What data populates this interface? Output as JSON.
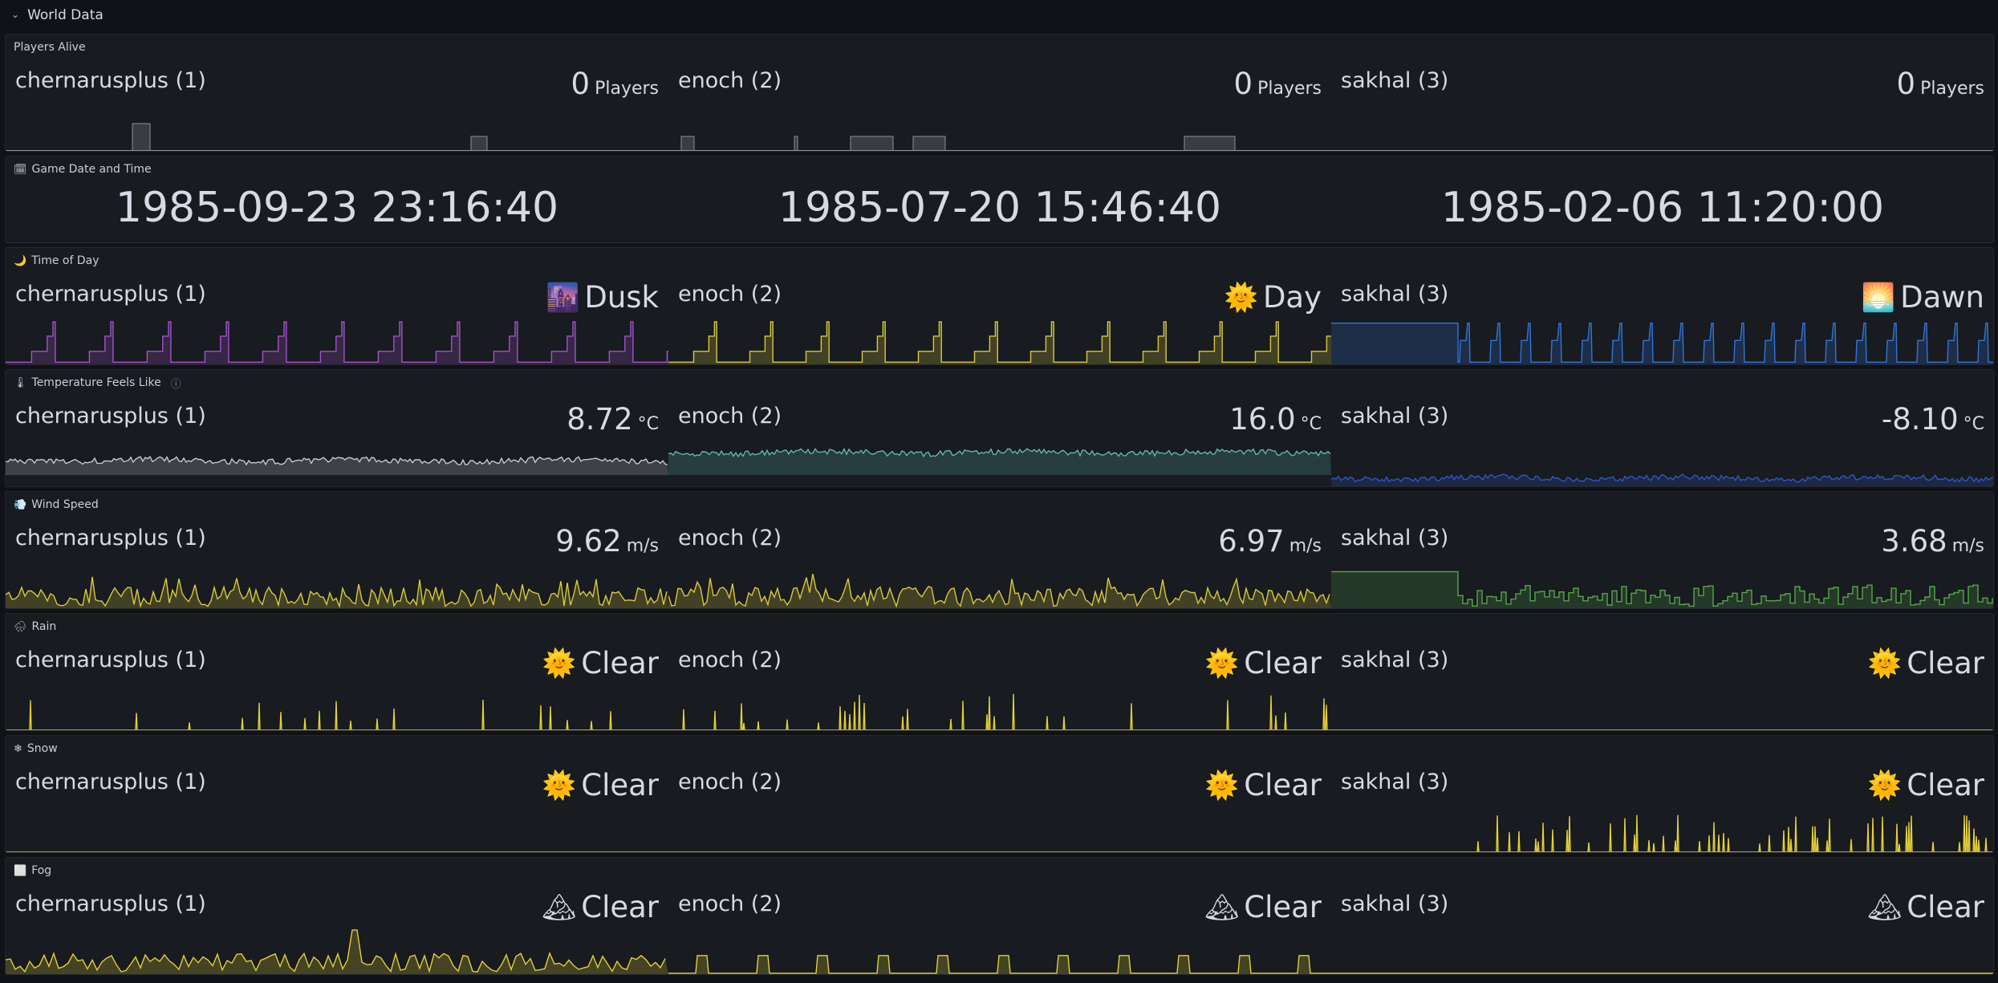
{
  "row": {
    "title": "World Data"
  },
  "icons": {
    "chevron": "chevron-down-icon",
    "calendar": "calendar-icon",
    "moon": "crescent-moon-icon",
    "thermometer": "thermometer-icon",
    "wind": "wind-icon",
    "rain": "rain-cloud-icon",
    "snow": "snowflake-icon",
    "fog": "fog-icon",
    "info": "info-icon"
  },
  "panels": [
    {
      "key": "players",
      "title": "Players Alive",
      "icon": "",
      "cells": [
        {
          "name": "chernarusplus (1)",
          "value": "0",
          "unit": "Players",
          "color": "#8f9094"
        },
        {
          "name": "enoch (2)",
          "value": "0",
          "unit": "Players",
          "color": "#8f9094"
        },
        {
          "name": "sakhal (3)",
          "value": "0",
          "unit": "Players",
          "color": "#8f9094"
        }
      ]
    },
    {
      "key": "datetime",
      "title": "Game Date and Time",
      "icon": "🗓",
      "cells": [
        {
          "value": "1985-09-23 23:16:40"
        },
        {
          "value": "1985-07-20 15:46:40"
        },
        {
          "value": "1985-02-06 11:20:00"
        }
      ]
    },
    {
      "key": "timeofday",
      "title": "Time of Day",
      "icon": "🌙",
      "cells": [
        {
          "name": "chernarusplus (1)",
          "emoji": "🌆",
          "value": "Dusk",
          "color": "#a352cc"
        },
        {
          "name": "enoch (2)",
          "emoji": "🌞",
          "value": "Day",
          "color": "#d9c93a"
        },
        {
          "name": "sakhal (3)",
          "emoji": "🌅",
          "value": "Dawn",
          "color": "#3274d9"
        }
      ]
    },
    {
      "key": "temperature",
      "title": "Temperature Feels Like",
      "icon": "🌡",
      "cells": [
        {
          "name": "chernarusplus (1)",
          "value": "8.72",
          "unit": "°C",
          "color": "#c8c9cf"
        },
        {
          "name": "enoch (2)",
          "value": "16.0",
          "unit": "°C",
          "color": "#5fb8b0"
        },
        {
          "name": "sakhal (3)",
          "value": "-8.10",
          "unit": "°C",
          "color": "#2f56c9"
        }
      ]
    },
    {
      "key": "wind",
      "title": "Wind Speed",
      "icon": "💨",
      "cells": [
        {
          "name": "chernarusplus (1)",
          "value": "9.62",
          "unit": "m/s",
          "color": "#d9c93a"
        },
        {
          "name": "enoch (2)",
          "value": "6.97",
          "unit": "m/s",
          "color": "#d9c93a"
        },
        {
          "name": "sakhal (3)",
          "value": "3.68",
          "unit": "m/s",
          "color": "#56a64b"
        }
      ]
    },
    {
      "key": "rain",
      "title": "Rain",
      "icon": "🌧",
      "cells": [
        {
          "name": "chernarusplus (1)",
          "emoji": "🌞",
          "value": "Clear",
          "color": "#e3d038"
        },
        {
          "name": "enoch (2)",
          "emoji": "🌞",
          "value": "Clear",
          "color": "#e3d038"
        },
        {
          "name": "sakhal (3)",
          "emoji": "🌞",
          "value": "Clear",
          "color": "#e3d038"
        }
      ]
    },
    {
      "key": "snow",
      "title": "Snow",
      "icon": "❄",
      "cells": [
        {
          "name": "chernarusplus (1)",
          "emoji": "🌞",
          "value": "Clear",
          "color": "#e3d038"
        },
        {
          "name": "enoch (2)",
          "emoji": "🌞",
          "value": "Clear",
          "color": "#e3d038"
        },
        {
          "name": "sakhal (3)",
          "emoji": "🌞",
          "value": "Clear",
          "color": "#e3d038"
        }
      ]
    },
    {
      "key": "fog",
      "title": "Fog",
      "icon": "⬜",
      "cells": [
        {
          "name": "chernarusplus (1)",
          "emoji": "🏔",
          "value": "Clear",
          "color": "#e3d038"
        },
        {
          "name": "enoch (2)",
          "emoji": "🏔",
          "value": "Clear",
          "color": "#e3d038"
        },
        {
          "name": "sakhal (3)",
          "emoji": "🏔",
          "value": "Clear",
          "color": "#e3d038"
        }
      ]
    }
  ]
}
